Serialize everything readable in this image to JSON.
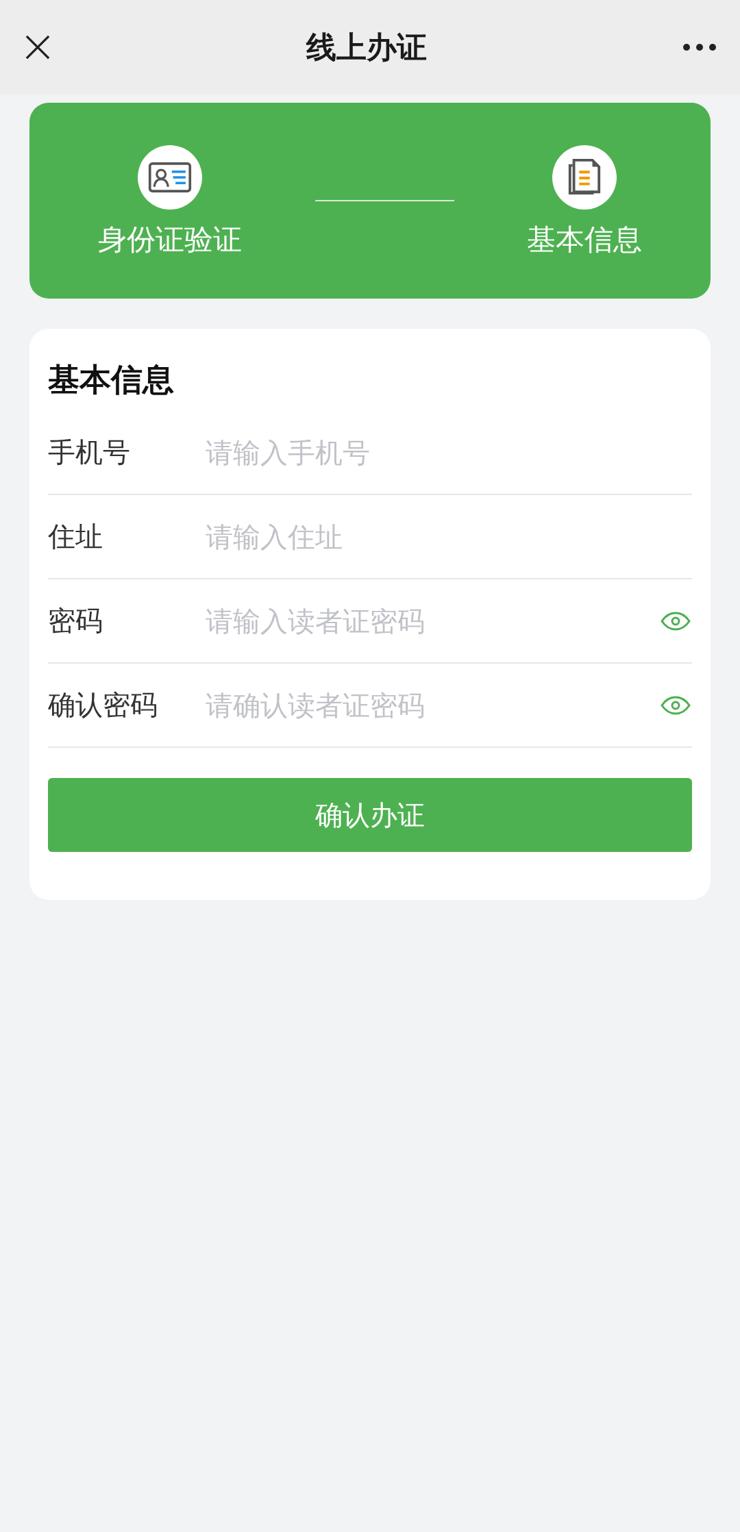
{
  "nav": {
    "title": "线上办证"
  },
  "steps": [
    {
      "kind": "id-card",
      "label": "身份证验证"
    },
    {
      "kind": "document",
      "label": "基本信息"
    }
  ],
  "form": {
    "title": "基本信息",
    "fields": [
      {
        "kind": "text",
        "label": "手机号",
        "placeholder": "请输入手机号"
      },
      {
        "kind": "text",
        "label": "住址",
        "placeholder": "请输入住址"
      },
      {
        "kind": "password",
        "label": "密码",
        "placeholder": "请输入读者证密码"
      },
      {
        "kind": "password",
        "label": "确认密码",
        "placeholder": "请确认读者证密码"
      }
    ],
    "submit": "确认办证"
  }
}
